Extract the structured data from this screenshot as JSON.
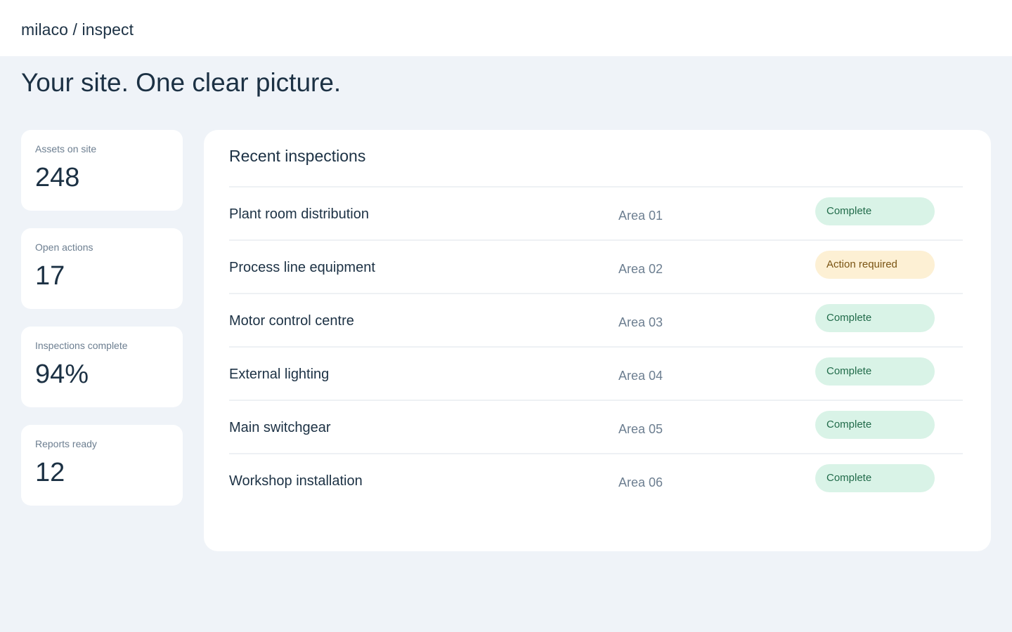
{
  "header": {
    "brand": "milaco / inspect"
  },
  "hero": {
    "headline": "Your site. One clear picture."
  },
  "stats": [
    {
      "label": "Assets on site",
      "value": "248"
    },
    {
      "label": "Open actions",
      "value": "17"
    },
    {
      "label": "Inspections complete",
      "value": "94%"
    },
    {
      "label": "Reports ready",
      "value": "12"
    }
  ],
  "inspections": {
    "title": "Recent inspections",
    "rows": [
      {
        "name": "Plant room distribution",
        "area": "Area 01",
        "status": "Complete",
        "status_type": "complete"
      },
      {
        "name": "Process line equipment",
        "area": "Area 02",
        "status": "Action required",
        "status_type": "action"
      },
      {
        "name": "Motor control centre",
        "area": "Area 03",
        "status": "Complete",
        "status_type": "complete"
      },
      {
        "name": "External lighting",
        "area": "Area 04",
        "status": "Complete",
        "status_type": "complete"
      },
      {
        "name": "Main switchgear",
        "area": "Area 05",
        "status": "Complete",
        "status_type": "complete"
      },
      {
        "name": "Workshop installation",
        "area": "Area 06",
        "status": "Complete",
        "status_type": "complete"
      }
    ]
  },
  "colors": {
    "page_background": "#eff3f8",
    "text_primary": "#1c3144",
    "text_muted": "#6c7e90",
    "complete_bg": "#d9f3e7",
    "complete_text": "#216b4a",
    "action_bg": "#fdf0d4",
    "action_text": "#7a5413"
  }
}
